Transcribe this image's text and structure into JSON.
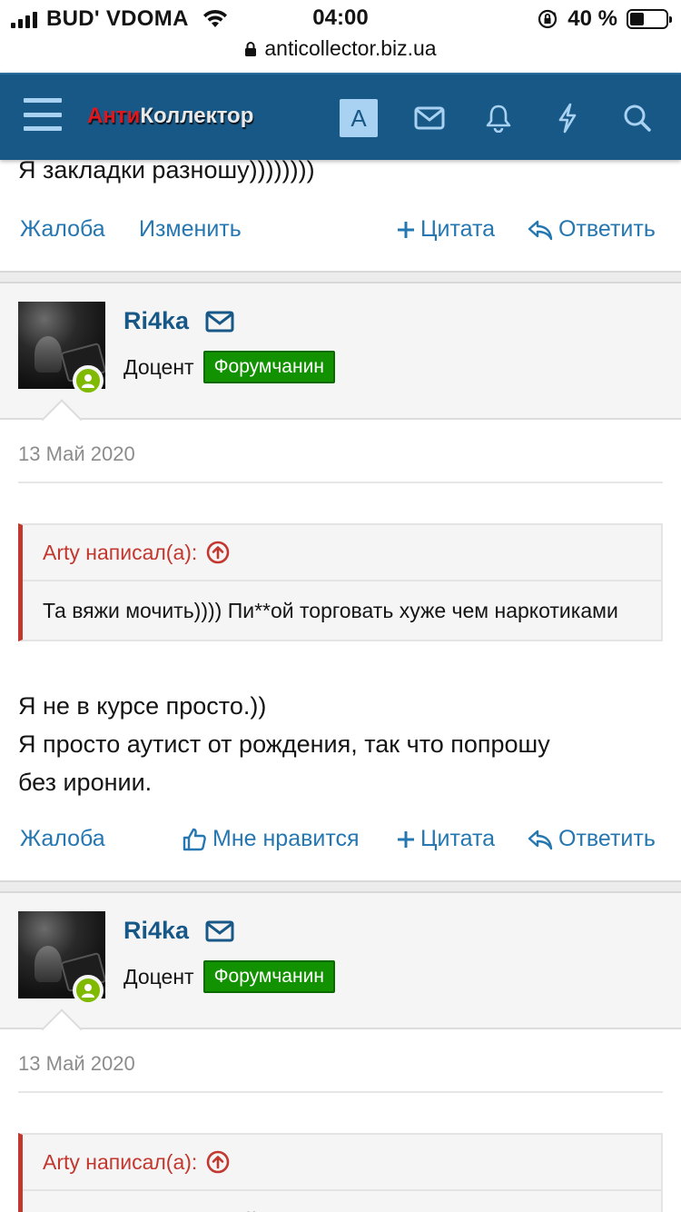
{
  "statusbar": {
    "carrier": "BUD' VDOMA",
    "time": "04:00",
    "battery_percent": "40 %",
    "battery_level": 0.4,
    "url": "anticollector.biz.ua"
  },
  "header": {
    "logo_red": "Анти",
    "logo_white": "Коллектор",
    "account_letter": "A",
    "icons": [
      "menu-icon",
      "envelope-icon",
      "bell-icon",
      "lightning-icon",
      "search-icon"
    ]
  },
  "prev_post": {
    "text_tail": "Я закладки разношу))))))))",
    "actions": {
      "report": "Жалоба",
      "edit": "Изменить",
      "quote": "Цитата",
      "reply": "Ответить"
    }
  },
  "posts": [
    {
      "username": "Ri4ka",
      "user_title": "Доцент",
      "badge": "Форумчанин",
      "date": "13 Май 2020",
      "quote_author": "Arty написал(а):",
      "quote_text": "Та вяжи мочить)))) Пи**ой торговать хуже чем наркотиками",
      "body_lines": [
        "Я не в курсе просто.))",
        "Я просто аутист от рождения, так что попрошу",
        "без иронии."
      ],
      "actions": {
        "report": "Жалоба",
        "like": "Мне нравится",
        "quote": "Цитата",
        "reply": "Ответить"
      }
    },
    {
      "username": "Ri4ka",
      "user_title": "Доцент",
      "badge": "Форумчанин",
      "date": "13 Май 2020",
      "quote_author": "Arty написал(а):",
      "quote_text": "Это телесериал такой)))))))"
    }
  ],
  "colors": {
    "header_bg": "#185886",
    "link": "#2577b1",
    "quote_accent": "#c2372e",
    "badge_bg": "#129200",
    "online": "#7fb900"
  }
}
